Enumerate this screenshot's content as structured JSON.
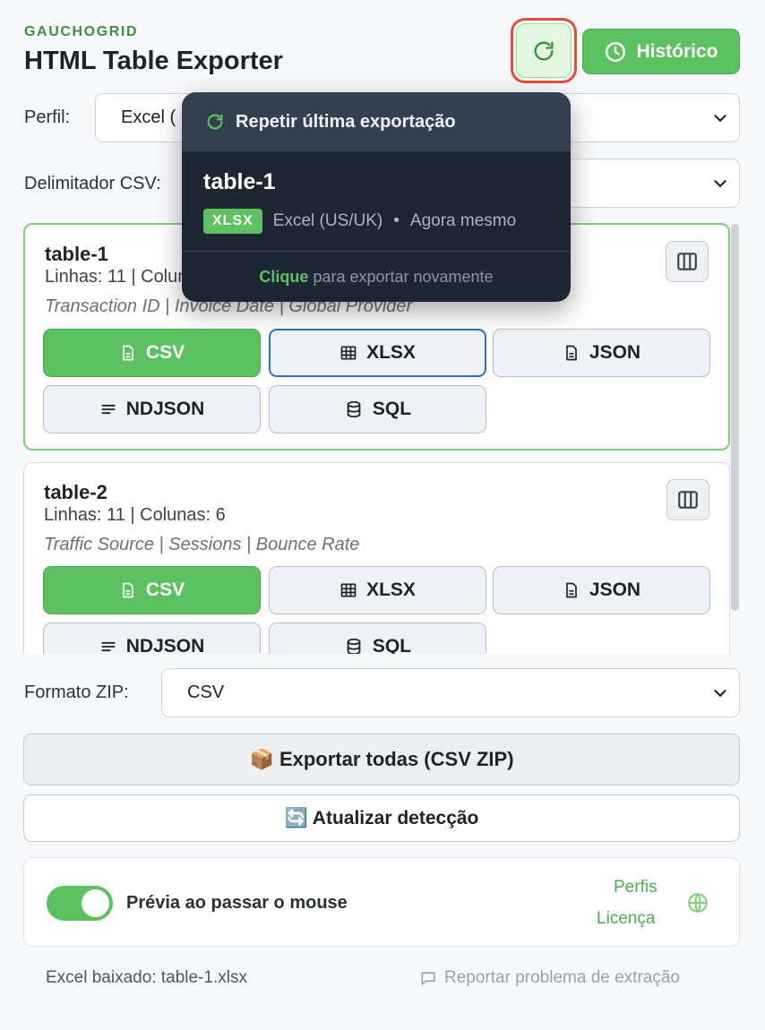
{
  "header": {
    "brand": "GAUCHOGRID",
    "title": "HTML Table Exporter",
    "history_label": "Histórico"
  },
  "profile": {
    "label": "Perfil:",
    "value": "Excel ("
  },
  "delimiter": {
    "label": "Delimitador CSV:"
  },
  "popover": {
    "heading": "Repetir última exportação",
    "table": "table-1",
    "format_badge": "XLSX",
    "profile": "Excel (US/UK)",
    "dot": "•",
    "time": "Agora mesmo",
    "footer_bold": "Clique",
    "footer_rest": " para exportar novamente"
  },
  "tables": [
    {
      "name": "table-1",
      "meta": "Linhas: 11 | Colunas: 6",
      "columns": "Transaction ID | Invoice Date | Global Provider",
      "buttons": {
        "csv": "CSV",
        "xlsx": "XLSX",
        "json": "JSON",
        "ndjson": "NDJSON",
        "sql": "SQL"
      }
    },
    {
      "name": "table-2",
      "meta": "Linhas: 11 | Colunas: 6",
      "columns": "Traffic Source | Sessions | Bounce Rate",
      "buttons": {
        "csv": "CSV",
        "xlsx": "XLSX",
        "json": "JSON",
        "ndjson": "NDJSON",
        "sql": "SQL"
      }
    }
  ],
  "zip": {
    "label": "Formato ZIP:",
    "value": "CSV"
  },
  "actions": {
    "export_all": "📦 Exportar todas (CSV ZIP)",
    "refresh": "🔄 Atualizar detecção"
  },
  "prefs": {
    "hover_preview_label": "Prévia ao passar o mouse",
    "hover_preview_on": true,
    "profiles_link": "Perfis",
    "license_link": "Licença"
  },
  "footer": {
    "status": "Excel baixado: table-1.xlsx",
    "report": "Reportar problema de extração"
  },
  "colors": {
    "accent_green": "#5cc160",
    "highlight_red": "#e74c3c",
    "focus_blue": "#2f6fc4",
    "popover_bg": "#1f2633"
  },
  "icons": [
    "refresh-icon",
    "clock-icon",
    "chevron-down-icon",
    "columns-icon",
    "file-icon",
    "table-grid-icon",
    "lines-icon",
    "database-icon",
    "globe-icon",
    "comment-icon"
  ]
}
